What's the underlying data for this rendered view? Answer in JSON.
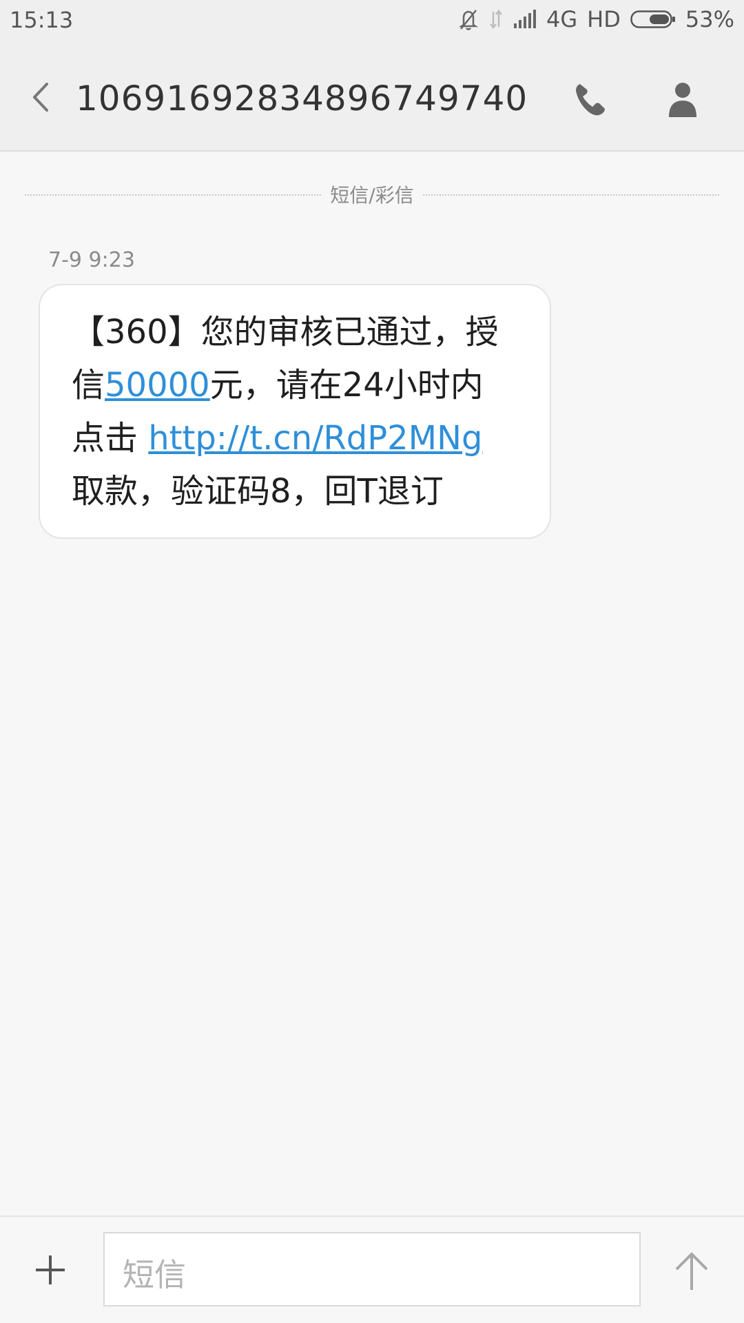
{
  "status_bar": {
    "time": "15:13",
    "network": "4G",
    "hd": "HD",
    "battery": "53%",
    "battery_level": 0.53,
    "icons": [
      "mute-bell-icon",
      "data-arrows-icon",
      "signal-icon",
      "battery-icon"
    ]
  },
  "header": {
    "back_icon": "back-chevron-icon",
    "title": "1069169283489674974 0",
    "call_icon": "phone-icon",
    "contact_icon": "person-icon"
  },
  "thread": {
    "divider_label": "短信/彩信",
    "timestamp": "7-9 9:23",
    "message": {
      "line1": "【360】您的审核已通过，授",
      "line2_prefix": "信",
      "line2_amount": "50000",
      "line2_suffix": "元，请在24小时内",
      "line3_prefix": "点击 ",
      "line3_link": "http://t.cn/RdP2MNg",
      "line4": "取款，验证码8，回T退订"
    },
    "link_color": "#2f8fd8"
  },
  "composer": {
    "add_icon": "plus-icon",
    "placeholder": "短信",
    "send_icon": "send-arrow-icon"
  }
}
